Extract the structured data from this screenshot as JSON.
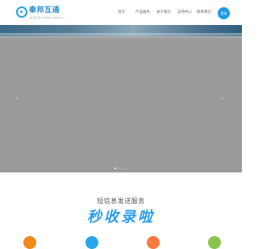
{
  "brand": {
    "name": "秦邦互通",
    "subtitle": "秦邦互通 INTERCONNECT",
    "accent_color": "#2aa2e4"
  },
  "nav": {
    "home": "首页",
    "products": "产品服务",
    "about": "关于我们",
    "support": "支持中心",
    "contact": "联系我们",
    "login": "登录"
  },
  "banner": {
    "prev_icon": "chevron-left-icon",
    "next_icon": "chevron-right-icon",
    "slide_count": 4,
    "active_slide": 1
  },
  "section": {
    "title": "短信息发送服务",
    "product_name": "秒收录啦",
    "product_color": "#2c9ee8"
  },
  "features": {
    "icon_colors": [
      "#f08a1c",
      "#2aa6e8",
      "#ff7a3c",
      "#8bc34a"
    ]
  }
}
